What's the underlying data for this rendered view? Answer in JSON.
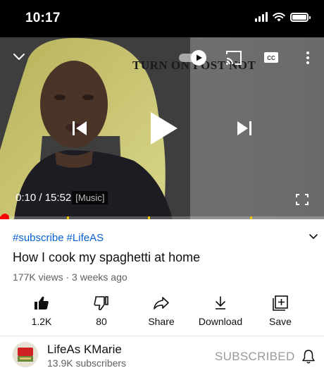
{
  "status_bar": {
    "time": "10:17"
  },
  "player": {
    "overlay_text": "TURN ON POST NOT",
    "current_time": "0:10",
    "separator": " / ",
    "duration": "15:52",
    "caption": "[Music]",
    "progress_fraction": 0.011,
    "accent_color": "#ff0000"
  },
  "video": {
    "tags": [
      "#subscribe",
      "#LifeAS"
    ],
    "title": "How I cook my spaghetti at home",
    "meta": "177K views · 3 weeks ago"
  },
  "actions": {
    "like": {
      "label": "1.2K",
      "icon": "thumbs-up-icon"
    },
    "dislike": {
      "label": "80",
      "icon": "thumbs-down-icon"
    },
    "share": {
      "label": "Share",
      "icon": "share-icon"
    },
    "download": {
      "label": "Download",
      "icon": "download-icon"
    },
    "save": {
      "label": "Save",
      "icon": "add-to-playlist-icon"
    }
  },
  "channel": {
    "name": "LifeAs KMarie",
    "subscribers": "13.9K subscribers",
    "subscribe_label": "SUBSCRIBED"
  }
}
